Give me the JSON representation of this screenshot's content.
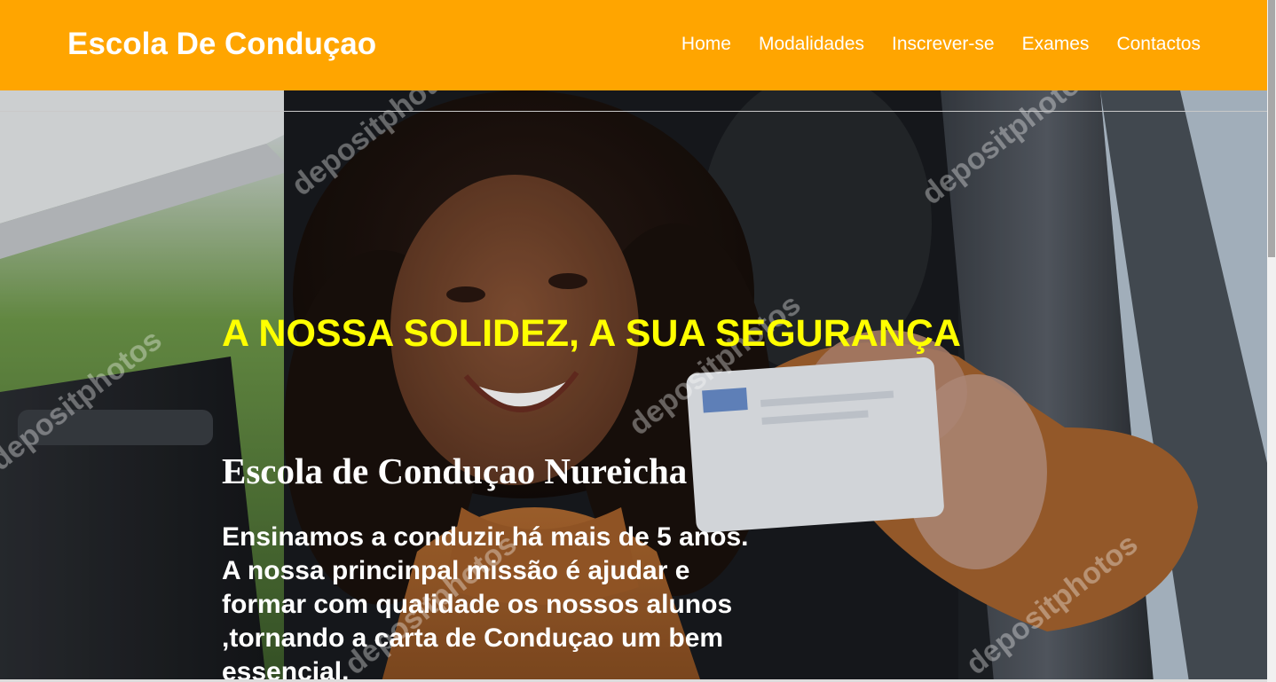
{
  "navbar": {
    "brand": "Escola De Conduçao",
    "links": [
      "Home",
      "Modalidades",
      "Inscrever-se",
      "Exames",
      "Contactos"
    ]
  },
  "hero": {
    "tagline": "A NOSSA SOLIDEZ, A SUA SEGURANÇA",
    "school_name": "Escola de Conduçao Nureicha",
    "description": "Ensinamos a conduzir há mais de 5 anos. A nossa princinpal missão é ajudar e formar com qualidade os nossos alunos ,tornando a carta de Conduçao um bem essencial.",
    "watermark": "depositphotos"
  },
  "colors": {
    "navbar_bg": "#ffa500",
    "tagline": "#ffff00",
    "text": "#ffffff"
  }
}
